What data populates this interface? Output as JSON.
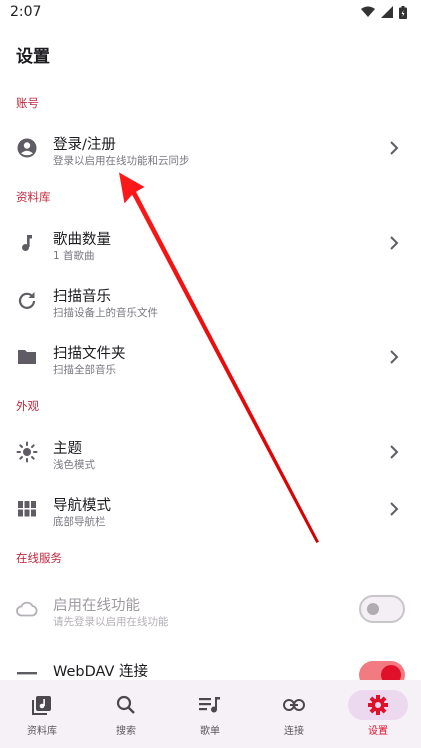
{
  "status": {
    "time": "2:07"
  },
  "page": {
    "title": "设置"
  },
  "sections": {
    "account": "账号",
    "library": "资料库",
    "appearance": "外观",
    "online": "在线服务"
  },
  "rows": {
    "login": {
      "title": "登录/注册",
      "sub": "登录以启用在线功能和云同步",
      "icon": "account-circle-icon"
    },
    "song_count": {
      "title": "歌曲数量",
      "sub": "1 首歌曲",
      "icon": "music-note-icon"
    },
    "scan_music": {
      "title": "扫描音乐",
      "sub": "扫描设备上的音乐文件",
      "icon": "refresh-icon"
    },
    "scan_folder": {
      "title": "扫描文件夹",
      "sub": "扫描全部音乐",
      "icon": "folder-icon"
    },
    "theme": {
      "title": "主题",
      "sub": "浅色模式",
      "icon": "sun-icon"
    },
    "nav_mode": {
      "title": "导航模式",
      "sub": "底部导航栏",
      "icon": "grid-icon"
    },
    "online_features": {
      "title": "启用在线功能",
      "sub": "请先登录以启用在线功能",
      "icon": "cloud-icon",
      "enabled": false
    },
    "webdav": {
      "title": "WebDAV 连接",
      "icon": "webdav-icon",
      "enabled": true
    }
  },
  "nav": [
    {
      "label": "资料库",
      "icon": "library-icon"
    },
    {
      "label": "搜索",
      "icon": "search-icon"
    },
    {
      "label": "歌单",
      "icon": "playlist-icon"
    },
    {
      "label": "连接",
      "icon": "link-icon"
    },
    {
      "label": "设置",
      "icon": "gear-icon",
      "active": true
    }
  ],
  "colors": {
    "accent": "#e0102a",
    "section": "#c0283f",
    "nav_bg": "#f6f1f6",
    "nav_active": "#ecd9f0"
  }
}
